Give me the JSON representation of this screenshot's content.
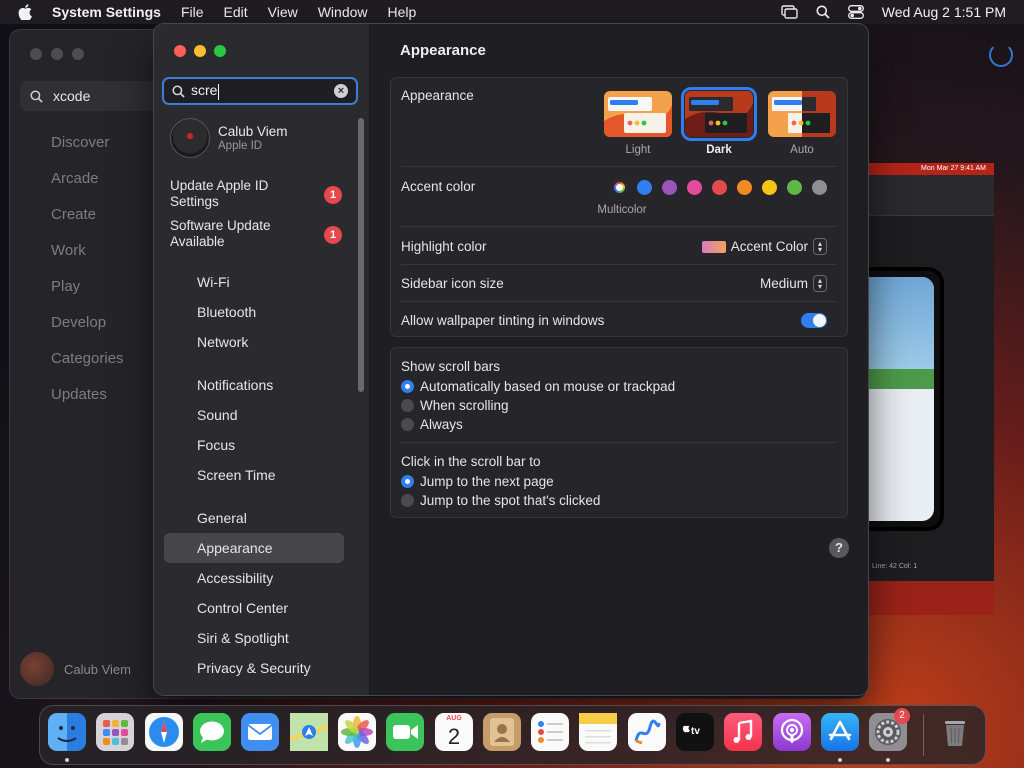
{
  "menubar": {
    "app_name": "System Settings",
    "menus": [
      "File",
      "Edit",
      "View",
      "Window",
      "Help"
    ],
    "datetime": "Wed Aug 2  1:51 PM"
  },
  "background_app": {
    "search_value": "xcode",
    "nav": [
      "Discover",
      "Arcade",
      "Create",
      "Work",
      "Play",
      "Develop",
      "Categories",
      "Updates"
    ],
    "user_name": "Calub Viem"
  },
  "xcode_window": {
    "menubar_clock": "Mon Mar 27  9:41 AM",
    "status": "Line: 42  Col: 1"
  },
  "sidebar": {
    "search_value": "scre",
    "account": {
      "name": "Calub Viem",
      "subtitle": "Apple ID"
    },
    "notices": [
      {
        "label": "Update Apple ID Settings",
        "badge": "1"
      },
      {
        "label": "Software Update Available",
        "badge": "1"
      }
    ],
    "items": [
      "Wi-Fi",
      "Bluetooth",
      "Network",
      "Notifications",
      "Sound",
      "Focus",
      "Screen Time",
      "General",
      "Appearance",
      "Accessibility",
      "Control Center",
      "Siri & Spotlight",
      "Privacy & Security"
    ],
    "selected": "Appearance"
  },
  "content": {
    "title": "Appearance",
    "appearance": {
      "label": "Appearance",
      "options": [
        "Light",
        "Dark",
        "Auto"
      ],
      "selected": "Dark"
    },
    "accent": {
      "label": "Accent color",
      "colors": [
        "#8e5bd6",
        "#2f7ff0",
        "#9a55b8",
        "#e44c9a",
        "#e5484d",
        "#f08a24",
        "#f5c518",
        "#5fb846",
        "#8e8e93"
      ],
      "selected_label": "Multicolor"
    },
    "highlight": {
      "label": "Highlight color",
      "value": "Accent Color"
    },
    "sidebar_icon": {
      "label": "Sidebar icon size",
      "value": "Medium"
    },
    "tinting": {
      "label": "Allow wallpaper tinting in windows",
      "on": true
    },
    "scroll_bars": {
      "label": "Show scroll bars",
      "options": [
        "Automatically based on mouse or trackpad",
        "When scrolling",
        "Always"
      ],
      "selected": 0
    },
    "click_scroll": {
      "label": "Click in the scroll bar to",
      "options": [
        "Jump to the next page",
        "Jump to the spot that's clicked"
      ],
      "selected": 0
    },
    "help_label": "?"
  },
  "dock": {
    "calendar_month": "AUG",
    "calendar_day": "2",
    "settings_badge": "2",
    "tv_label": "tv"
  }
}
